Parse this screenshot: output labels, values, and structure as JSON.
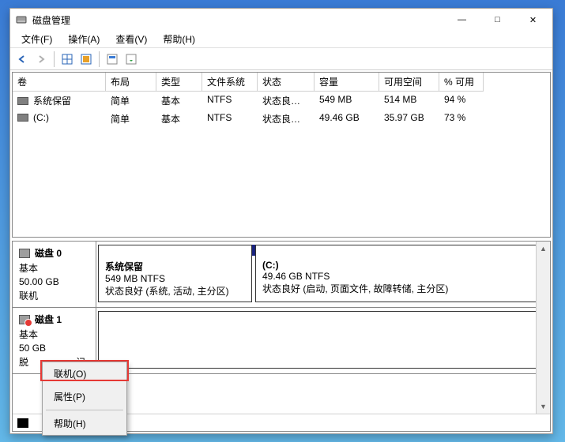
{
  "window": {
    "title": "磁盘管理"
  },
  "menubar": {
    "file": "文件(F)",
    "action": "操作(A)",
    "view": "查看(V)",
    "help": "帮助(H)"
  },
  "columns": {
    "vol": "卷",
    "layout": "布局",
    "type": "类型",
    "fs": "文件系统",
    "status": "状态",
    "cap": "容量",
    "free": "可用空间",
    "pct": "% 可用"
  },
  "volumes": [
    {
      "name": "系统保留",
      "layout": "简单",
      "type": "基本",
      "fs": "NTFS",
      "status": "状态良好 (…",
      "cap": "549 MB",
      "free": "514 MB",
      "pct": "94 %"
    },
    {
      "name": "(C:)",
      "layout": "简单",
      "type": "基本",
      "fs": "NTFS",
      "status": "状态良好 (…",
      "cap": "49.46 GB",
      "free": "35.97 GB",
      "pct": "73 %"
    }
  ],
  "disk0": {
    "title": "磁盘 0",
    "type": "基本",
    "size": "50.00 GB",
    "state": "联机",
    "part_a_title": "系统保留",
    "part_a_sub": "549 MB NTFS",
    "part_a_status": "状态良好 (系统, 活动, 主分区)",
    "part_b_title": "(C:)",
    "part_b_sub": "49.46 GB NTFS",
    "part_b_status": "状态良好 (启动, 页面文件, 故障转储, 主分区)"
  },
  "disk1": {
    "title": "磁盘 1",
    "type": "基本",
    "size_trail": " GB",
    "state_lead": "脱",
    "state_trail": "记"
  },
  "context": {
    "online": "联机(O)",
    "properties": "属性(P)",
    "help": "帮助(H)"
  }
}
